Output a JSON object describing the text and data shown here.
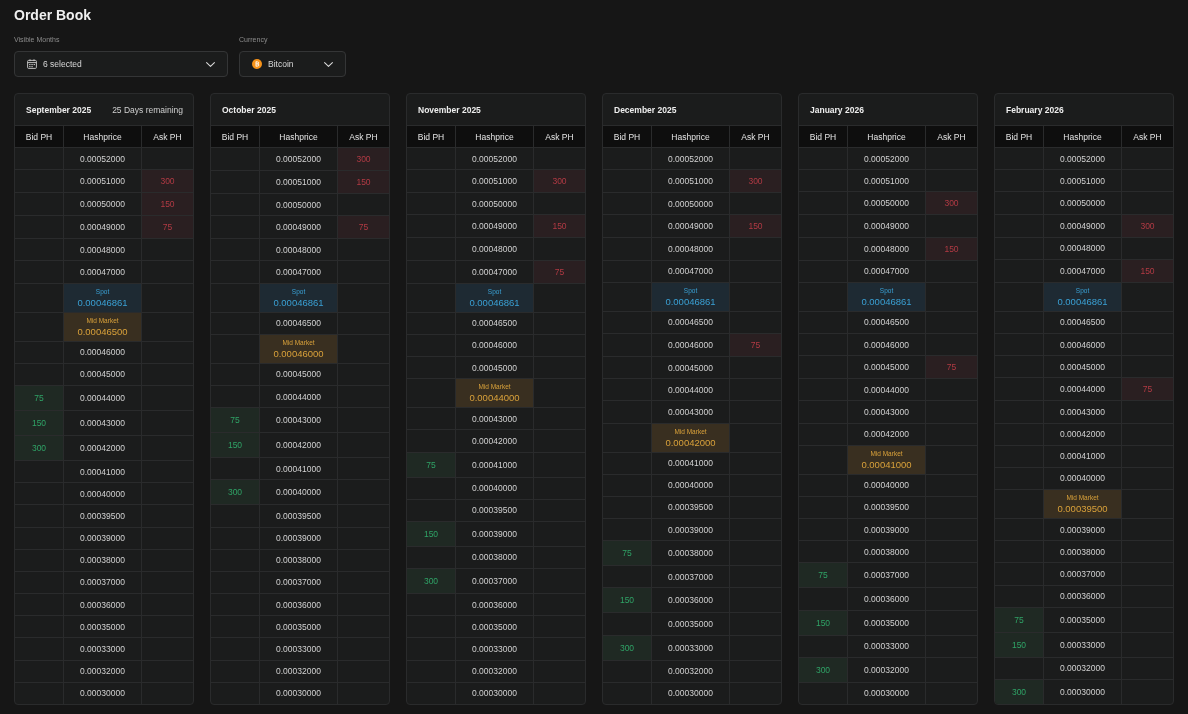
{
  "title": "Order Book",
  "filters": [
    {
      "kind": "months",
      "label": "Visible Months",
      "value": "6 selected"
    },
    {
      "kind": "currency",
      "label": "Currency",
      "value": "Bitcoin"
    }
  ],
  "months": [
    {
      "title": "September 2025",
      "subtitle": "25 Days remaining",
      "columns": [
        "Bid PH",
        "Hashprice",
        "Ask PH"
      ],
      "rows": [
        {
          "kind": "level",
          "price": "0.00052000"
        },
        {
          "kind": "level",
          "price": "0.00051000",
          "ask": "300"
        },
        {
          "kind": "level",
          "price": "0.00050000",
          "ask": "150"
        },
        {
          "kind": "level",
          "price": "0.00049000",
          "ask": "75"
        },
        {
          "kind": "level",
          "price": "0.00048000"
        },
        {
          "kind": "level",
          "price": "0.00047000"
        },
        {
          "kind": "spot",
          "label": "Spot",
          "price": "0.00046861"
        },
        {
          "kind": "mid",
          "label": "Mid Market",
          "price": "0.00046500"
        },
        {
          "kind": "level",
          "price": "0.00046000"
        },
        {
          "kind": "level",
          "price": "0.00045000"
        },
        {
          "kind": "level",
          "price": "0.00044000",
          "bid": "75"
        },
        {
          "kind": "level",
          "price": "0.00043000",
          "bid": "150"
        },
        {
          "kind": "level",
          "price": "0.00042000",
          "bid": "300"
        },
        {
          "kind": "level",
          "price": "0.00041000"
        },
        {
          "kind": "level",
          "price": "0.00040000"
        },
        {
          "kind": "level",
          "price": "0.00039500"
        },
        {
          "kind": "level",
          "price": "0.00039000"
        },
        {
          "kind": "level",
          "price": "0.00038000"
        },
        {
          "kind": "level",
          "price": "0.00037000"
        },
        {
          "kind": "level",
          "price": "0.00036000"
        },
        {
          "kind": "level",
          "price": "0.00035000"
        },
        {
          "kind": "level",
          "price": "0.00033000"
        },
        {
          "kind": "level",
          "price": "0.00032000"
        },
        {
          "kind": "level",
          "price": "0.00030000"
        }
      ]
    },
    {
      "title": "October 2025",
      "columns": [
        "Bid PH",
        "Hashprice",
        "Ask PH"
      ],
      "rows": [
        {
          "kind": "level",
          "price": "0.00052000",
          "ask": "300"
        },
        {
          "kind": "level",
          "price": "0.00051000",
          "ask": "150"
        },
        {
          "kind": "level",
          "price": "0.00050000"
        },
        {
          "kind": "level",
          "price": "0.00049000",
          "ask": "75"
        },
        {
          "kind": "level",
          "price": "0.00048000"
        },
        {
          "kind": "level",
          "price": "0.00047000"
        },
        {
          "kind": "spot",
          "label": "Spot",
          "price": "0.00046861"
        },
        {
          "kind": "level",
          "price": "0.00046500"
        },
        {
          "kind": "mid",
          "label": "Mid Market",
          "price": "0.00046000"
        },
        {
          "kind": "level",
          "price": "0.00045000"
        },
        {
          "kind": "level",
          "price": "0.00044000"
        },
        {
          "kind": "level",
          "price": "0.00043000",
          "bid": "75"
        },
        {
          "kind": "level",
          "price": "0.00042000",
          "bid": "150"
        },
        {
          "kind": "level",
          "price": "0.00041000"
        },
        {
          "kind": "level",
          "price": "0.00040000",
          "bid": "300"
        },
        {
          "kind": "level",
          "price": "0.00039500"
        },
        {
          "kind": "level",
          "price": "0.00039000"
        },
        {
          "kind": "level",
          "price": "0.00038000"
        },
        {
          "kind": "level",
          "price": "0.00037000"
        },
        {
          "kind": "level",
          "price": "0.00036000"
        },
        {
          "kind": "level",
          "price": "0.00035000"
        },
        {
          "kind": "level",
          "price": "0.00033000"
        },
        {
          "kind": "level",
          "price": "0.00032000"
        },
        {
          "kind": "level",
          "price": "0.00030000"
        }
      ]
    },
    {
      "title": "November 2025",
      "columns": [
        "Bid PH",
        "Hashprice",
        "Ask PH"
      ],
      "rows": [
        {
          "kind": "level",
          "price": "0.00052000"
        },
        {
          "kind": "level",
          "price": "0.00051000",
          "ask": "300"
        },
        {
          "kind": "level",
          "price": "0.00050000"
        },
        {
          "kind": "level",
          "price": "0.00049000",
          "ask": "150"
        },
        {
          "kind": "level",
          "price": "0.00048000"
        },
        {
          "kind": "level",
          "price": "0.00047000",
          "ask": "75"
        },
        {
          "kind": "spot",
          "label": "Spot",
          "price": "0.00046861"
        },
        {
          "kind": "level",
          "price": "0.00046500"
        },
        {
          "kind": "level",
          "price": "0.00046000"
        },
        {
          "kind": "level",
          "price": "0.00045000"
        },
        {
          "kind": "mid",
          "label": "Mid Market",
          "price": "0.00044000"
        },
        {
          "kind": "level",
          "price": "0.00043000"
        },
        {
          "kind": "level",
          "price": "0.00042000"
        },
        {
          "kind": "level",
          "price": "0.00041000",
          "bid": "75"
        },
        {
          "kind": "level",
          "price": "0.00040000"
        },
        {
          "kind": "level",
          "price": "0.00039500"
        },
        {
          "kind": "level",
          "price": "0.00039000",
          "bid": "150"
        },
        {
          "kind": "level",
          "price": "0.00038000"
        },
        {
          "kind": "level",
          "price": "0.00037000",
          "bid": "300"
        },
        {
          "kind": "level",
          "price": "0.00036000"
        },
        {
          "kind": "level",
          "price": "0.00035000"
        },
        {
          "kind": "level",
          "price": "0.00033000"
        },
        {
          "kind": "level",
          "price": "0.00032000"
        },
        {
          "kind": "level",
          "price": "0.00030000"
        }
      ]
    },
    {
      "title": "December 2025",
      "columns": [
        "Bid PH",
        "Hashprice",
        "Ask PH"
      ],
      "rows": [
        {
          "kind": "level",
          "price": "0.00052000"
        },
        {
          "kind": "level",
          "price": "0.00051000",
          "ask": "300"
        },
        {
          "kind": "level",
          "price": "0.00050000"
        },
        {
          "kind": "level",
          "price": "0.00049000",
          "ask": "150"
        },
        {
          "kind": "level",
          "price": "0.00048000"
        },
        {
          "kind": "level",
          "price": "0.00047000"
        },
        {
          "kind": "spot",
          "label": "Spot",
          "price": "0.00046861"
        },
        {
          "kind": "level",
          "price": "0.00046500"
        },
        {
          "kind": "level",
          "price": "0.00046000",
          "ask": "75"
        },
        {
          "kind": "level",
          "price": "0.00045000"
        },
        {
          "kind": "level",
          "price": "0.00044000"
        },
        {
          "kind": "level",
          "price": "0.00043000"
        },
        {
          "kind": "mid",
          "label": "Mid Market",
          "price": "0.00042000"
        },
        {
          "kind": "level",
          "price": "0.00041000"
        },
        {
          "kind": "level",
          "price": "0.00040000"
        },
        {
          "kind": "level",
          "price": "0.00039500"
        },
        {
          "kind": "level",
          "price": "0.00039000"
        },
        {
          "kind": "level",
          "price": "0.00038000",
          "bid": "75"
        },
        {
          "kind": "level",
          "price": "0.00037000"
        },
        {
          "kind": "level",
          "price": "0.00036000",
          "bid": "150"
        },
        {
          "kind": "level",
          "price": "0.00035000"
        },
        {
          "kind": "level",
          "price": "0.00033000",
          "bid": "300"
        },
        {
          "kind": "level",
          "price": "0.00032000"
        },
        {
          "kind": "level",
          "price": "0.00030000"
        }
      ]
    },
    {
      "title": "January 2026",
      "columns": [
        "Bid PH",
        "Hashprice",
        "Ask PH"
      ],
      "rows": [
        {
          "kind": "level",
          "price": "0.00052000"
        },
        {
          "kind": "level",
          "price": "0.00051000"
        },
        {
          "kind": "level",
          "price": "0.00050000",
          "ask": "300"
        },
        {
          "kind": "level",
          "price": "0.00049000"
        },
        {
          "kind": "level",
          "price": "0.00048000",
          "ask": "150"
        },
        {
          "kind": "level",
          "price": "0.00047000"
        },
        {
          "kind": "spot",
          "label": "Spot",
          "price": "0.00046861"
        },
        {
          "kind": "level",
          "price": "0.00046500"
        },
        {
          "kind": "level",
          "price": "0.00046000"
        },
        {
          "kind": "level",
          "price": "0.00045000",
          "ask": "75"
        },
        {
          "kind": "level",
          "price": "0.00044000"
        },
        {
          "kind": "level",
          "price": "0.00043000"
        },
        {
          "kind": "level",
          "price": "0.00042000"
        },
        {
          "kind": "mid",
          "label": "Mid Market",
          "price": "0.00041000"
        },
        {
          "kind": "level",
          "price": "0.00040000"
        },
        {
          "kind": "level",
          "price": "0.00039500"
        },
        {
          "kind": "level",
          "price": "0.00039000"
        },
        {
          "kind": "level",
          "price": "0.00038000"
        },
        {
          "kind": "level",
          "price": "0.00037000",
          "bid": "75"
        },
        {
          "kind": "level",
          "price": "0.00036000"
        },
        {
          "kind": "level",
          "price": "0.00035000",
          "bid": "150"
        },
        {
          "kind": "level",
          "price": "0.00033000"
        },
        {
          "kind": "level",
          "price": "0.00032000",
          "bid": "300"
        },
        {
          "kind": "level",
          "price": "0.00030000"
        }
      ]
    },
    {
      "title": "February 2026",
      "columns": [
        "Bid PH",
        "Hashprice",
        "Ask PH"
      ],
      "rows": [
        {
          "kind": "level",
          "price": "0.00052000"
        },
        {
          "kind": "level",
          "price": "0.00051000"
        },
        {
          "kind": "level",
          "price": "0.00050000"
        },
        {
          "kind": "level",
          "price": "0.00049000",
          "ask": "300"
        },
        {
          "kind": "level",
          "price": "0.00048000"
        },
        {
          "kind": "level",
          "price": "0.00047000",
          "ask": "150"
        },
        {
          "kind": "spot",
          "label": "Spot",
          "price": "0.00046861"
        },
        {
          "kind": "level",
          "price": "0.00046500"
        },
        {
          "kind": "level",
          "price": "0.00046000"
        },
        {
          "kind": "level",
          "price": "0.00045000"
        },
        {
          "kind": "level",
          "price": "0.00044000",
          "ask": "75"
        },
        {
          "kind": "level",
          "price": "0.00043000"
        },
        {
          "kind": "level",
          "price": "0.00042000"
        },
        {
          "kind": "level",
          "price": "0.00041000"
        },
        {
          "kind": "level",
          "price": "0.00040000"
        },
        {
          "kind": "mid",
          "label": "Mid Market",
          "price": "0.00039500"
        },
        {
          "kind": "level",
          "price": "0.00039000"
        },
        {
          "kind": "level",
          "price": "0.00038000"
        },
        {
          "kind": "level",
          "price": "0.00037000"
        },
        {
          "kind": "level",
          "price": "0.00036000"
        },
        {
          "kind": "level",
          "price": "0.00035000",
          "bid": "75"
        },
        {
          "kind": "level",
          "price": "0.00033000",
          "bid": "150"
        },
        {
          "kind": "level",
          "price": "0.00032000"
        },
        {
          "kind": "level",
          "price": "0.00030000",
          "bid": "300"
        }
      ]
    }
  ]
}
